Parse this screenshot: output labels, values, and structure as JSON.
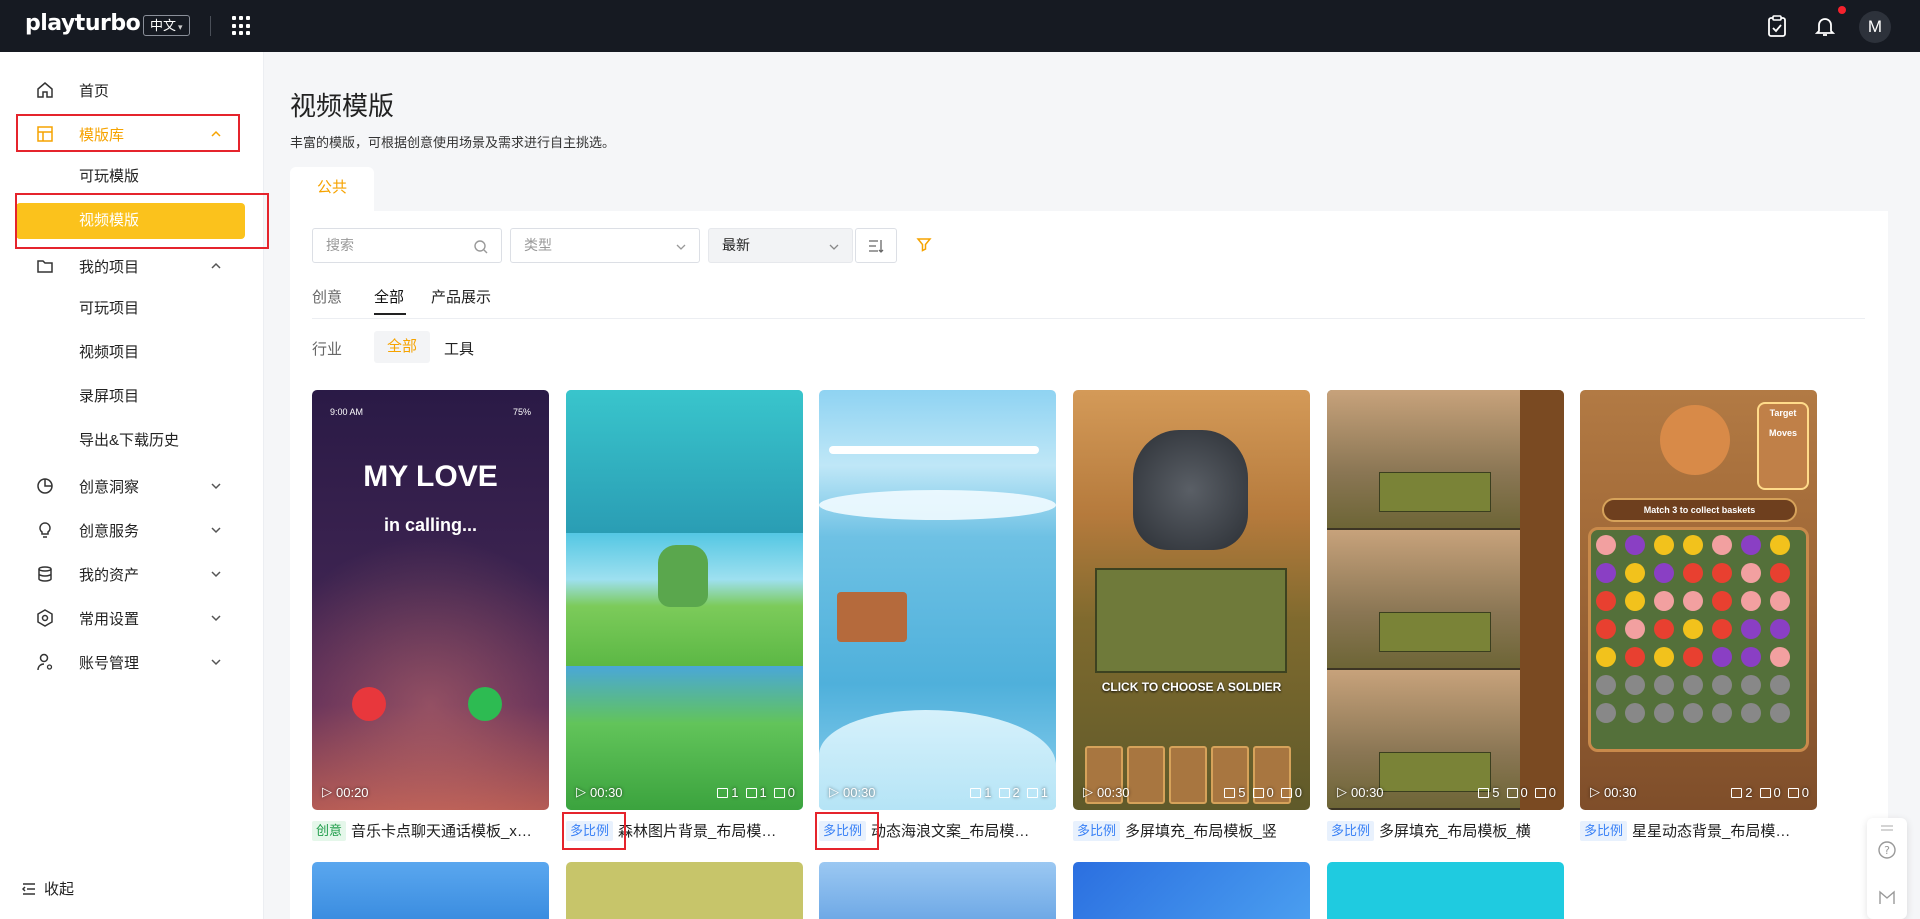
{
  "topbar": {
    "logo": "playturbo",
    "language": "中文",
    "avatar_letter": "M"
  },
  "sidebar": {
    "home": "首页",
    "template_library": "模版库",
    "playable_template": "可玩模版",
    "video_template": "视频模版",
    "my_projects": "我的项目",
    "playable_project": "可玩项目",
    "video_project": "视频项目",
    "recording_project": "录屏项目",
    "export_history": "导出&下载历史",
    "creative_insights": "创意洞察",
    "creative_services": "创意服务",
    "my_assets": "我的资产",
    "settings": "常用设置",
    "account": "账号管理",
    "collapse": "收起"
  },
  "main": {
    "title": "视频模版",
    "subtitle": "丰富的模版，可根据创意使用场景及需求进行自主挑选。",
    "tab_public": "公共",
    "search_placeholder": "搜索",
    "type_placeholder": "类型",
    "sort_value": "最新",
    "tabs": [
      "创意",
      "全部",
      "产品展示"
    ],
    "industry_label": "行业",
    "industry_chips": [
      "全部",
      "工具"
    ]
  },
  "cards": [
    {
      "badge": "创意",
      "title": "音乐卡点聊天通话模板_x…",
      "duration": "00:20",
      "stats": [],
      "thumb_text": [
        "MY LOVE",
        "in calling...",
        "9:00 AM",
        "75%"
      ]
    },
    {
      "badge": "多比例",
      "title": "森林图片背景_布局模…",
      "duration": "00:30",
      "stats": [
        "1",
        "1",
        "0"
      ]
    },
    {
      "badge": "多比例",
      "title": "动态海浪文案_布局模…",
      "duration": "00:30",
      "stats": [
        "1",
        "2",
        "1"
      ]
    },
    {
      "badge": "多比例",
      "title": "多屏填充_布局模板_竖",
      "duration": "00:30",
      "stats": [
        "5",
        "0",
        "0"
      ],
      "thumb_text": [
        "CLICK TO CHOOSE A SOLDIER"
      ]
    },
    {
      "badge": "多比例",
      "title": "多屏填充_布局模板_横",
      "duration": "00:30",
      "stats": [
        "5",
        "0",
        "0"
      ]
    },
    {
      "badge": "多比例",
      "title": "星星动态背景_布局模…",
      "duration": "00:30",
      "stats": [
        "2",
        "0",
        "0"
      ],
      "thumb_text": [
        "Match 3 to collect baskets",
        "Target",
        "Moves"
      ]
    }
  ],
  "colors": {
    "accent": "#fbc21c",
    "accent_text": "#f6a300",
    "topbar": "#161a22",
    "highlight": "#e5242c"
  }
}
